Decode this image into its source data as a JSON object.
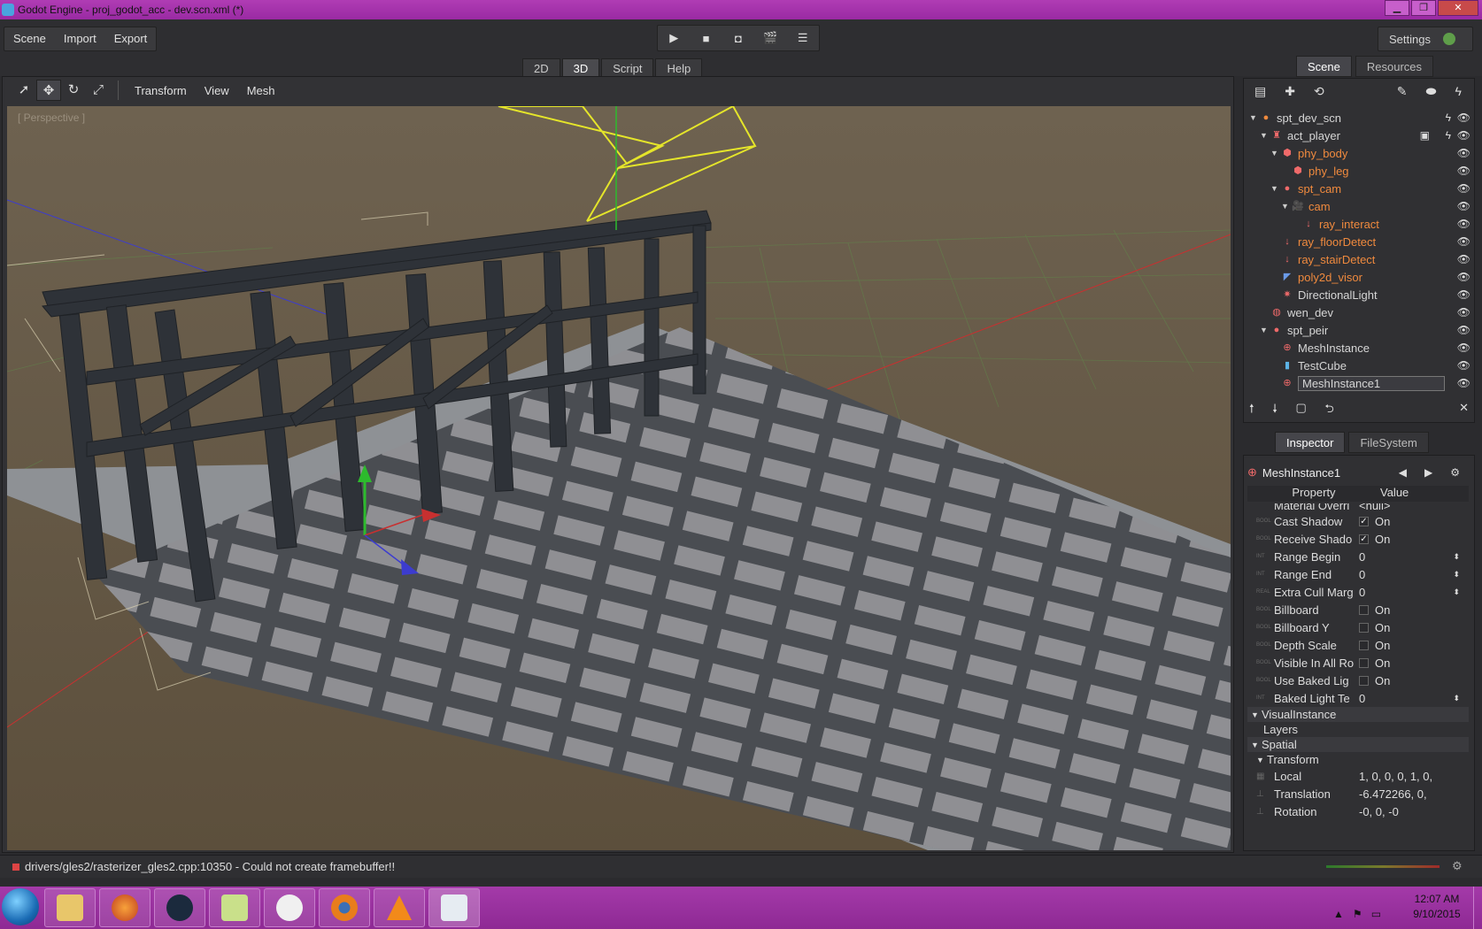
{
  "window": {
    "title": "Godot Engine - proj_godot_acc - dev.scn.xml (*)"
  },
  "menu": {
    "items": [
      "Scene",
      "Import",
      "Export"
    ],
    "settings": "Settings"
  },
  "playbar": {
    "buttons": [
      "▶",
      "■",
      "◘",
      "🎬",
      "☰"
    ]
  },
  "modes": {
    "tabs": [
      "2D",
      "3D",
      "Script",
      "Help"
    ],
    "active": "3D"
  },
  "viewport": {
    "toolbar_menus": [
      "Transform",
      "View",
      "Mesh"
    ],
    "label": "[ Perspective ]"
  },
  "scene_dock": {
    "tabs": [
      "Scene",
      "Resources"
    ],
    "toolbar_icons": [
      "new-scene-icon",
      "add-node-icon",
      "replace-icon",
      "edit-icon",
      "instance-icon",
      "script-icon"
    ],
    "tree": [
      {
        "label": "spt_dev_scn",
        "color": "#e0e0e0"
      },
      {
        "label": "act_player",
        "color": "#e0e0e0"
      },
      {
        "label": "phy_body",
        "color": "#f08a3e"
      },
      {
        "label": "phy_leg",
        "color": "#f08a3e"
      },
      {
        "label": "spt_cam",
        "color": "#f08a3e"
      },
      {
        "label": "cam",
        "color": "#f08a3e"
      },
      {
        "label": "ray_interact",
        "color": "#f08a3e"
      },
      {
        "label": "ray_floorDetect",
        "color": "#f08a3e"
      },
      {
        "label": "ray_stairDetect",
        "color": "#f08a3e"
      },
      {
        "label": "poly2d_visor",
        "color": "#f08a3e"
      },
      {
        "label": "DirectionalLight",
        "color": "#e0e0e0"
      },
      {
        "label": "wen_dev",
        "color": "#e0e0e0"
      },
      {
        "label": "spt_peir",
        "color": "#e0e0e0"
      },
      {
        "label": "MeshInstance",
        "color": "#e0e0e0"
      },
      {
        "label": "TestCube",
        "color": "#e0e0e0"
      },
      {
        "label": "MeshInstance1",
        "color": "#ffffff"
      }
    ]
  },
  "inspector_dock": {
    "tabs": [
      "Inspector",
      "FileSystem"
    ],
    "node": "MeshInstance1",
    "col_property": "Property",
    "col_value": "Value",
    "props": [
      {
        "type": "",
        "name": "Material Overri",
        "value": "<null>"
      },
      {
        "type": "BOOL",
        "name": "Cast Shadow",
        "value": "On",
        "checked": true
      },
      {
        "type": "BOOL",
        "name": "Receive Shado",
        "value": "On",
        "checked": true
      },
      {
        "type": "INT",
        "name": "Range Begin",
        "value": "0"
      },
      {
        "type": "INT",
        "name": "Range End",
        "value": "0"
      },
      {
        "type": "REAL",
        "name": "Extra Cull Marg",
        "value": "0"
      },
      {
        "type": "BOOL",
        "name": "Billboard",
        "value": "On",
        "checked": false
      },
      {
        "type": "BOOL",
        "name": "Billboard Y",
        "value": "On",
        "checked": false
      },
      {
        "type": "BOOL",
        "name": "Depth Scale",
        "value": "On",
        "checked": false
      },
      {
        "type": "BOOL",
        "name": "Visible In All Ro",
        "value": "On",
        "checked": false
      },
      {
        "type": "BOOL",
        "name": "Use Baked Lig",
        "value": "On",
        "checked": false
      },
      {
        "type": "INT",
        "name": "Baked Light Te",
        "value": "0"
      }
    ],
    "section_visual": "VisualInstance",
    "layers": "Layers",
    "section_spatial": "Spatial",
    "sub_transform": "Transform",
    "spatial_props": [
      {
        "name": "Local",
        "value": "1, 0, 0, 0, 1, 0,"
      },
      {
        "name": "Translation",
        "value": "-6.472266, 0,"
      },
      {
        "name": "Rotation",
        "value": "-0, 0, -0"
      }
    ]
  },
  "status": {
    "message": "drivers/gles2/rasterizer_gles2.cpp:10350 - Could not create framebuffer!!"
  },
  "taskbar": {
    "apps": [
      "explorer-icon",
      "firefox-icon",
      "steam-icon",
      "notepad-icon",
      "godot-icon",
      "blender-icon",
      "vlc-icon",
      "godot-editor-icon"
    ],
    "time": "12:07 AM",
    "date": "9/10/2015"
  }
}
